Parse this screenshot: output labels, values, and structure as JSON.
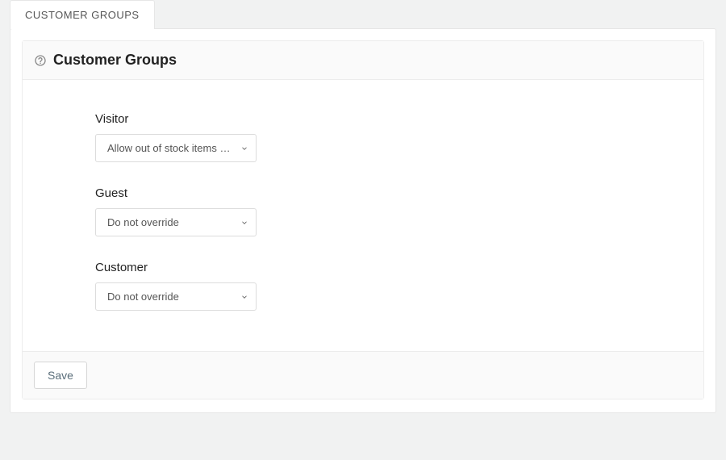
{
  "tab": {
    "label": "CUSTOMER GROUPS"
  },
  "panel": {
    "title": "Customer Groups"
  },
  "options": {
    "allow": "Allow out of stock items to be added to the shopping cart",
    "none": "Do not override"
  },
  "fields": {
    "visitor": {
      "label": "Visitor",
      "value": "allow"
    },
    "guest": {
      "label": "Guest",
      "value": "none"
    },
    "customer": {
      "label": "Customer",
      "value": "none"
    }
  },
  "footer": {
    "save": "Save"
  }
}
